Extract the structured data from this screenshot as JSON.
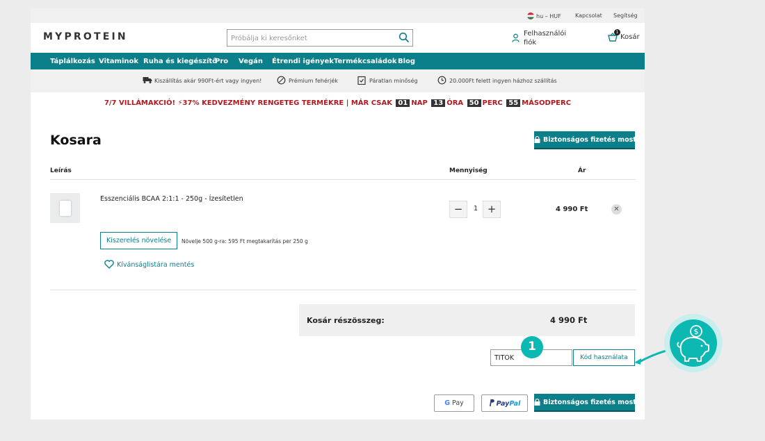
{
  "utility": {
    "locale": "hu – HUF",
    "contact": "Kapcsolat",
    "help": "Segítség"
  },
  "header": {
    "logo": "MYPROTEIN",
    "search_placeholder": "Próbálja ki keresőnket",
    "account": "Felhasználói fiók",
    "cart_label": "Kosár",
    "cart_count": "1"
  },
  "nav": [
    "Táplálkozás",
    "Vitaminok",
    "Ruha és kiegészítő",
    "Pro",
    "Vegán",
    "Étrendi igények",
    "Termékcsaládok",
    "Blog"
  ],
  "usp": [
    {
      "icon": "truck-icon",
      "text": "Kiszállítás akár 990Ft-ért vagy ingyen!"
    },
    {
      "icon": "leaf-icon",
      "text": "Prémium fehérjék"
    },
    {
      "icon": "clipboard-check-icon",
      "text": "Páratlan minőség"
    },
    {
      "icon": "clock-icon",
      "text": "20.000Ft felett ingyen házhoz szállítás"
    }
  ],
  "promo": {
    "text": "7/7 VILLÁMAKCIÓ! ⚡37% KEDVEZMÉNY RENGETEG TERMÉKRE | MÁR CSAK",
    "days": "01",
    "days_label": "NAP",
    "hours": "13",
    "hours_label": "ÓRA",
    "minutes": "50",
    "minutes_label": "PERC",
    "seconds": "55",
    "seconds_label": "MÁSODPERC"
  },
  "cart": {
    "title": "Kosara",
    "checkout_label": "Biztonságos fizetés most",
    "col_description": "Leírás",
    "col_quantity": "Mennyiség",
    "col_price": "Ár",
    "item": {
      "name": "Esszenciális BCAA 2:1:1 - 250g - Ízesítetlen",
      "quantity": "1",
      "price": "4 990 Ft",
      "upsize_label": "Kiszerelés növelése",
      "upsize_note": "Növelje 500 g-ra: 595 Ft megtakarítás per 250 g",
      "wishlist_label": "Kívánságlistára mentés"
    },
    "subtotal_label": "Kosár részösszeg:",
    "subtotal_value": "4 990 Ft",
    "discount_code": "TITOK",
    "apply_code_label": "Kód használata",
    "step_number": "1",
    "gpay_label": "Pay",
    "paypal_a": "Pay",
    "paypal_b": "Pal"
  },
  "colors": {
    "brand_teal": "#0b7f8a",
    "promo_red": "#b2191e",
    "callout_teal": "#0cb8b2"
  }
}
